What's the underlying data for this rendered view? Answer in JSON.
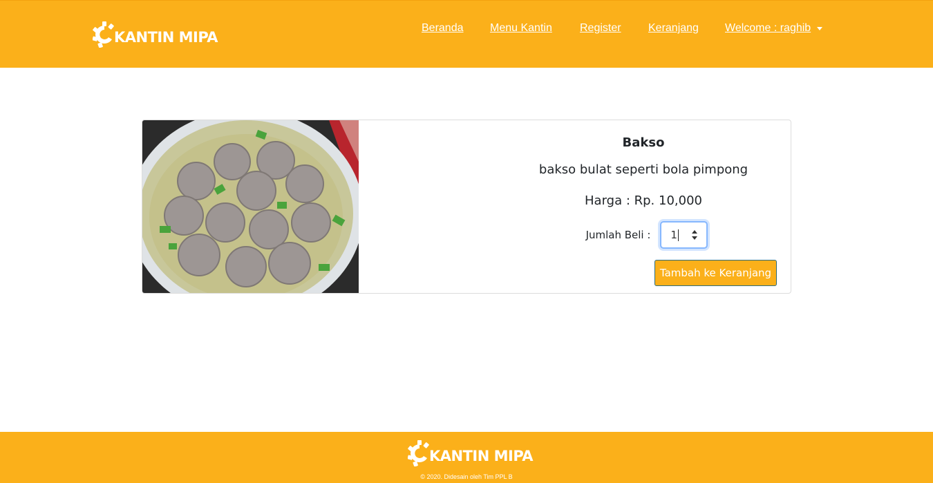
{
  "brand": {
    "name": "KANTIN MIPA",
    "logo_icon": "gear-icon"
  },
  "nav": {
    "items": [
      {
        "label": "Beranda"
      },
      {
        "label": "Menu Kantin"
      },
      {
        "label": "Register"
      },
      {
        "label": "Keranjang"
      }
    ],
    "user_menu": "Welcome : raghib"
  },
  "product": {
    "name": "Bakso",
    "description": "bakso bulat seperti bola pimpong",
    "price": "Harga : Rp. 10,000",
    "qty_label": "Jumlah Beli :",
    "qty_value": "1",
    "add_button": "Tambah ke Keranjang",
    "image_alt": "bakso-photo"
  },
  "footer": {
    "brand": "KANTIN MIPA",
    "copyright": "© 2020. Didesain oleh Tim PPL B"
  },
  "colors": {
    "primary": "#fbb01a",
    "text": "#212529",
    "button_border": "#2a6c80"
  }
}
